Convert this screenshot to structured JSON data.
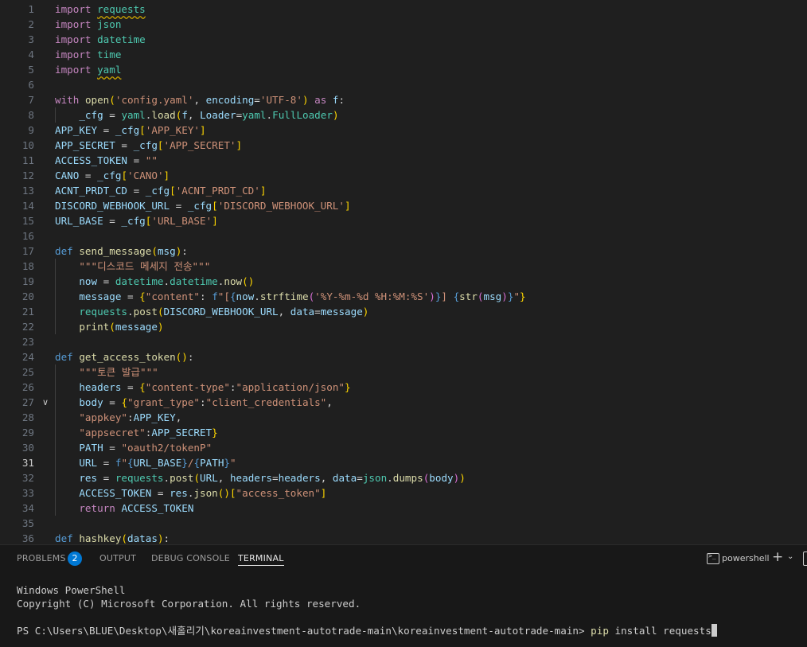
{
  "editor": {
    "active_line": 31,
    "lines": [
      {
        "n": "1",
        "t": [
          [
            "kw",
            "import"
          ],
          [
            "p",
            " "
          ],
          [
            "cls squig",
            "requests"
          ]
        ]
      },
      {
        "n": "2",
        "t": [
          [
            "kw",
            "import"
          ],
          [
            "p",
            " "
          ],
          [
            "cls",
            "json"
          ]
        ]
      },
      {
        "n": "3",
        "t": [
          [
            "kw",
            "import"
          ],
          [
            "p",
            " "
          ],
          [
            "cls",
            "datetime"
          ]
        ]
      },
      {
        "n": "4",
        "t": [
          [
            "kw",
            "import"
          ],
          [
            "p",
            " "
          ],
          [
            "cls",
            "time"
          ]
        ]
      },
      {
        "n": "5",
        "t": [
          [
            "kw",
            "import"
          ],
          [
            "p",
            " "
          ],
          [
            "cls squig",
            "yaml"
          ]
        ]
      },
      {
        "n": "6",
        "t": []
      },
      {
        "n": "7",
        "t": [
          [
            "kw",
            "with"
          ],
          [
            "p",
            " "
          ],
          [
            "fn",
            "open"
          ],
          [
            "b1",
            "("
          ],
          [
            "str",
            "'config.yaml'"
          ],
          [
            "p",
            ", "
          ],
          [
            "var",
            "encoding"
          ],
          [
            "op",
            "="
          ],
          [
            "str",
            "'UTF-8'"
          ],
          [
            "b1",
            ")"
          ],
          [
            "p",
            " "
          ],
          [
            "kw",
            "as"
          ],
          [
            "p",
            " "
          ],
          [
            "var",
            "f"
          ],
          [
            "p",
            ":"
          ]
        ]
      },
      {
        "n": "8",
        "g": true,
        "t": [
          [
            "p",
            "    "
          ],
          [
            "var",
            "_cfg"
          ],
          [
            "op",
            " = "
          ],
          [
            "cls",
            "yaml"
          ],
          [
            "p",
            "."
          ],
          [
            "fn",
            "load"
          ],
          [
            "b1",
            "("
          ],
          [
            "var",
            "f"
          ],
          [
            "p",
            ", "
          ],
          [
            "var",
            "Loader"
          ],
          [
            "op",
            "="
          ],
          [
            "cls",
            "yaml"
          ],
          [
            "p",
            "."
          ],
          [
            "cls",
            "FullLoader"
          ],
          [
            "b1",
            ")"
          ]
        ]
      },
      {
        "n": "9",
        "t": [
          [
            "var",
            "APP_KEY"
          ],
          [
            "op",
            " = "
          ],
          [
            "var",
            "_cfg"
          ],
          [
            "b1",
            "["
          ],
          [
            "str",
            "'APP_KEY'"
          ],
          [
            "b1",
            "]"
          ]
        ]
      },
      {
        "n": "10",
        "t": [
          [
            "var",
            "APP_SECRET"
          ],
          [
            "op",
            " = "
          ],
          [
            "var",
            "_cfg"
          ],
          [
            "b1",
            "["
          ],
          [
            "str",
            "'APP_SECRET'"
          ],
          [
            "b1",
            "]"
          ]
        ]
      },
      {
        "n": "11",
        "t": [
          [
            "var",
            "ACCESS_TOKEN"
          ],
          [
            "op",
            " = "
          ],
          [
            "str",
            "\"\""
          ]
        ]
      },
      {
        "n": "12",
        "t": [
          [
            "var",
            "CANO"
          ],
          [
            "op",
            " = "
          ],
          [
            "var",
            "_cfg"
          ],
          [
            "b1",
            "["
          ],
          [
            "str",
            "'CANO'"
          ],
          [
            "b1",
            "]"
          ]
        ]
      },
      {
        "n": "13",
        "t": [
          [
            "var",
            "ACNT_PRDT_CD"
          ],
          [
            "op",
            " = "
          ],
          [
            "var",
            "_cfg"
          ],
          [
            "b1",
            "["
          ],
          [
            "str",
            "'ACNT_PRDT_CD'"
          ],
          [
            "b1",
            "]"
          ]
        ]
      },
      {
        "n": "14",
        "t": [
          [
            "var",
            "DISCORD_WEBHOOK_URL"
          ],
          [
            "op",
            " = "
          ],
          [
            "var",
            "_cfg"
          ],
          [
            "b1",
            "["
          ],
          [
            "str",
            "'DISCORD_WEBHOOK_URL'"
          ],
          [
            "b1",
            "]"
          ]
        ]
      },
      {
        "n": "15",
        "t": [
          [
            "var",
            "URL_BASE"
          ],
          [
            "op",
            " = "
          ],
          [
            "var",
            "_cfg"
          ],
          [
            "b1",
            "["
          ],
          [
            "str",
            "'URL_BASE'"
          ],
          [
            "b1",
            "]"
          ]
        ]
      },
      {
        "n": "16",
        "t": []
      },
      {
        "n": "17",
        "t": [
          [
            "dk",
            "def"
          ],
          [
            "p",
            " "
          ],
          [
            "fn",
            "send_message"
          ],
          [
            "b1",
            "("
          ],
          [
            "var",
            "msg"
          ],
          [
            "b1",
            ")"
          ],
          [
            "p",
            ":"
          ]
        ]
      },
      {
        "n": "18",
        "g": true,
        "t": [
          [
            "p",
            "    "
          ],
          [
            "str",
            "\"\"\"디스코드 메세지 전송\"\"\""
          ]
        ]
      },
      {
        "n": "19",
        "g": true,
        "t": [
          [
            "p",
            "    "
          ],
          [
            "var",
            "now"
          ],
          [
            "op",
            " = "
          ],
          [
            "cls",
            "datetime"
          ],
          [
            "p",
            "."
          ],
          [
            "cls",
            "datetime"
          ],
          [
            "p",
            "."
          ],
          [
            "fn",
            "now"
          ],
          [
            "b1",
            "()"
          ]
        ]
      },
      {
        "n": "20",
        "g": true,
        "t": [
          [
            "p",
            "    "
          ],
          [
            "var",
            "message"
          ],
          [
            "op",
            " = "
          ],
          [
            "b1",
            "{"
          ],
          [
            "str",
            "\"content\""
          ],
          [
            "p",
            ": "
          ],
          [
            "dk",
            "f"
          ],
          [
            "str",
            "\"["
          ],
          [
            "dk",
            "{"
          ],
          [
            "var",
            "now"
          ],
          [
            "p",
            "."
          ],
          [
            "fn",
            "strftime"
          ],
          [
            "b2",
            "("
          ],
          [
            "str",
            "'%Y-%m-%d %H:%M:%S'"
          ],
          [
            "b2",
            ")"
          ],
          [
            "dk",
            "}"
          ],
          [
            "str",
            "] "
          ],
          [
            "dk",
            "{"
          ],
          [
            "fn",
            "str"
          ],
          [
            "b2",
            "("
          ],
          [
            "var",
            "msg"
          ],
          [
            "b2",
            ")"
          ],
          [
            "dk",
            "}"
          ],
          [
            "str",
            "\""
          ],
          [
            "b1",
            "}"
          ]
        ]
      },
      {
        "n": "21",
        "g": true,
        "t": [
          [
            "p",
            "    "
          ],
          [
            "cls",
            "requests"
          ],
          [
            "p",
            "."
          ],
          [
            "fn",
            "post"
          ],
          [
            "b1",
            "("
          ],
          [
            "var",
            "DISCORD_WEBHOOK_URL"
          ],
          [
            "p",
            ", "
          ],
          [
            "var",
            "data"
          ],
          [
            "op",
            "="
          ],
          [
            "var",
            "message"
          ],
          [
            "b1",
            ")"
          ]
        ]
      },
      {
        "n": "22",
        "g": true,
        "t": [
          [
            "p",
            "    "
          ],
          [
            "fn",
            "print"
          ],
          [
            "b1",
            "("
          ],
          [
            "var",
            "message"
          ],
          [
            "b1",
            ")"
          ]
        ]
      },
      {
        "n": "23",
        "t": []
      },
      {
        "n": "24",
        "t": [
          [
            "dk",
            "def"
          ],
          [
            "p",
            " "
          ],
          [
            "fn",
            "get_access_token"
          ],
          [
            "b1",
            "()"
          ],
          [
            "p",
            ":"
          ]
        ]
      },
      {
        "n": "25",
        "g": true,
        "t": [
          [
            "p",
            "    "
          ],
          [
            "str",
            "\"\"\"토큰 발급\"\"\""
          ]
        ]
      },
      {
        "n": "26",
        "g": true,
        "t": [
          [
            "p",
            "    "
          ],
          [
            "var",
            "headers"
          ],
          [
            "op",
            " = "
          ],
          [
            "b1",
            "{"
          ],
          [
            "str",
            "\"content-type\""
          ],
          [
            "p",
            ":"
          ],
          [
            "str",
            "\"application/json\""
          ],
          [
            "b1",
            "}"
          ]
        ]
      },
      {
        "n": "27",
        "g": true,
        "f": true,
        "t": [
          [
            "p",
            "    "
          ],
          [
            "var",
            "body"
          ],
          [
            "op",
            " = "
          ],
          [
            "b1",
            "{"
          ],
          [
            "str",
            "\"grant_type\""
          ],
          [
            "p",
            ":"
          ],
          [
            "str",
            "\"client_credentials\""
          ],
          [
            "p",
            ","
          ]
        ]
      },
      {
        "n": "28",
        "g": true,
        "t": [
          [
            "p",
            "    "
          ],
          [
            "str",
            "\"appkey\""
          ],
          [
            "p",
            ":"
          ],
          [
            "var",
            "APP_KEY"
          ],
          [
            "p",
            ","
          ]
        ]
      },
      {
        "n": "29",
        "g": true,
        "t": [
          [
            "p",
            "    "
          ],
          [
            "str",
            "\"appsecret\""
          ],
          [
            "p",
            ":"
          ],
          [
            "var",
            "APP_SECRET"
          ],
          [
            "b1",
            "}"
          ]
        ]
      },
      {
        "n": "30",
        "g": true,
        "t": [
          [
            "p",
            "    "
          ],
          [
            "var",
            "PATH"
          ],
          [
            "op",
            " = "
          ],
          [
            "str",
            "\"oauth2/tokenP\""
          ]
        ]
      },
      {
        "n": "31",
        "g": true,
        "t": [
          [
            "p",
            "    "
          ],
          [
            "var",
            "URL"
          ],
          [
            "op",
            " = "
          ],
          [
            "dk",
            "f"
          ],
          [
            "str",
            "\""
          ],
          [
            "dk",
            "{"
          ],
          [
            "var",
            "URL_BASE"
          ],
          [
            "dk",
            "}"
          ],
          [
            "str",
            "/"
          ],
          [
            "dk",
            "{"
          ],
          [
            "var",
            "PATH"
          ],
          [
            "dk",
            "}"
          ],
          [
            "str",
            "\""
          ]
        ]
      },
      {
        "n": "32",
        "g": true,
        "t": [
          [
            "p",
            "    "
          ],
          [
            "var",
            "res"
          ],
          [
            "op",
            " = "
          ],
          [
            "cls",
            "requests"
          ],
          [
            "p",
            "."
          ],
          [
            "fn",
            "post"
          ],
          [
            "b1",
            "("
          ],
          [
            "var",
            "URL"
          ],
          [
            "p",
            ", "
          ],
          [
            "var",
            "headers"
          ],
          [
            "op",
            "="
          ],
          [
            "var",
            "headers"
          ],
          [
            "p",
            ", "
          ],
          [
            "var",
            "data"
          ],
          [
            "op",
            "="
          ],
          [
            "cls",
            "json"
          ],
          [
            "p",
            "."
          ],
          [
            "fn",
            "dumps"
          ],
          [
            "b2",
            "("
          ],
          [
            "var",
            "body"
          ],
          [
            "b2",
            ")"
          ],
          [
            "b1",
            ")"
          ]
        ]
      },
      {
        "n": "33",
        "g": true,
        "t": [
          [
            "p",
            "    "
          ],
          [
            "var",
            "ACCESS_TOKEN"
          ],
          [
            "op",
            " = "
          ],
          [
            "var",
            "res"
          ],
          [
            "p",
            "."
          ],
          [
            "fn",
            "json"
          ],
          [
            "b1",
            "()"
          ],
          [
            "b1",
            "["
          ],
          [
            "str",
            "\"access_token\""
          ],
          [
            "b1",
            "]"
          ]
        ]
      },
      {
        "n": "34",
        "g": true,
        "t": [
          [
            "p",
            "    "
          ],
          [
            "kw",
            "return"
          ],
          [
            "p",
            " "
          ],
          [
            "var",
            "ACCESS_TOKEN"
          ]
        ]
      },
      {
        "n": "35",
        "t": []
      },
      {
        "n": "36",
        "t": [
          [
            "dk",
            "def"
          ],
          [
            "p",
            " "
          ],
          [
            "fn",
            "hashkey"
          ],
          [
            "b1",
            "("
          ],
          [
            "var",
            "datas"
          ],
          [
            "b1",
            ")"
          ],
          [
            "p",
            ":"
          ]
        ]
      }
    ]
  },
  "panel": {
    "tabs": [
      {
        "label": "PROBLEMS",
        "name": "tab-problems"
      },
      {
        "label": "OUTPUT",
        "name": "tab-output"
      },
      {
        "label": "DEBUG CONSOLE",
        "name": "tab-debug-console"
      },
      {
        "label": "TERMINAL",
        "name": "tab-terminal"
      }
    ],
    "problems_count": "2",
    "shell_label": "powershell",
    "icons": {
      "shell": "terminal-icon",
      "add": "plus-icon",
      "dropdown": "chevron-down-icon"
    },
    "terminal": {
      "line1": "Windows PowerShell",
      "line2": "Copyright (C) Microsoft Corporation. All rights reserved.",
      "prompt": "PS C:\\Users\\BLUE\\Desktop\\새홀리기\\koreainvestment-autotrade-main\\koreainvestment-autotrade-main> ",
      "cmd": "pip",
      "args": " install requests"
    }
  }
}
